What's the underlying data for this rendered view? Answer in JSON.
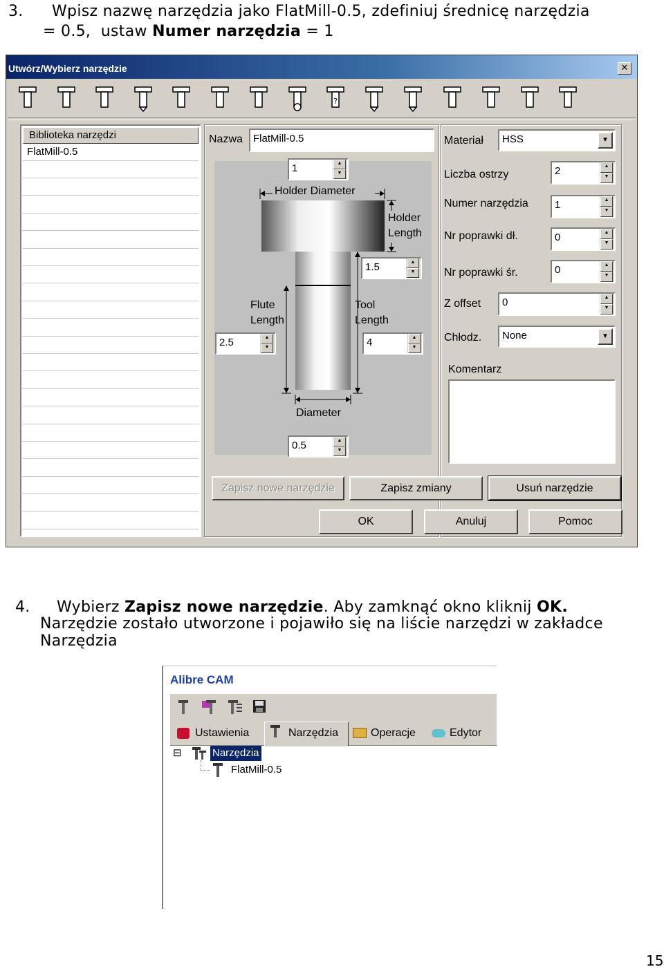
{
  "doc": {
    "step3_num": "3.",
    "step3_line1": "Wpisz nazwę narzędzia jako FlatMill-0.5, zdefiniuj średnicę narzędzia",
    "step3_line2_pre": "= 0.5,  ustaw ",
    "step3_line2_bold": "Numer narzędzia",
    "step3_line2_post": " = 1",
    "step4_num": "4.",
    "step4_pre": "Wybierz ",
    "step4_bold": "Zapisz nowe narzędzie",
    "step4_mid": ". Aby zamknąć okno kliknij ",
    "step4_ok": "OK",
    "step4_end": ".",
    "step4_line2": "Narzędzie zostało utworzone i pojawiło się na liście narzędzi w zakładce",
    "step4_line3": "Narzędzia",
    "page_number": "15"
  },
  "dialog": {
    "title": "Utwórz/Wybierz narzędzie",
    "close_glyph": "✕",
    "toolbar_count": 15,
    "library": {
      "header": "Biblioteka narzędzi",
      "items": [
        "FlatMill-0.5"
      ]
    },
    "name_label": "Nazwa",
    "name_value": "FlatMill-0.5",
    "diagram": {
      "holder_diameter_label": "Holder Diameter",
      "holder_length_label": "Holder Length",
      "flute_length_label": "Flute Length",
      "tool_length_label": "Tool Length",
      "diameter_label": "Diameter",
      "holder_diameter_value": "1",
      "holder_length_value": "1.5",
      "flute_length_value": "2.5",
      "tool_length_value": "4",
      "diameter_value": "0.5"
    },
    "props": {
      "material_label": "Materiał",
      "material_value": "HSS",
      "flutes_label": "Liczba ostrzy",
      "flutes_value": "2",
      "tool_number_label": "Numer narzędzia",
      "tool_number_value": "1",
      "length_offset_label": "Nr poprawki dł.",
      "length_offset_value": "0",
      "dia_offset_label": "Nr poprawki śr.",
      "dia_offset_value": "0",
      "z_offset_label": "Z offset",
      "z_offset_value": "0",
      "coolant_label": "Chłodz.",
      "coolant_value": "None",
      "comment_label": "Komentarz",
      "comment_value": ""
    },
    "buttons": {
      "save_new": "Zapisz nowe narzędzie",
      "save_changes": "Zapisz zmiany",
      "delete_tool": "Usuń narzędzie",
      "ok": "OK",
      "cancel": "Anuluj",
      "help": "Pomoc"
    }
  },
  "alibre": {
    "title": "Alibre CAM",
    "tabs": [
      "Ustawienia",
      "Narzędzia",
      "Operacje",
      "Edytor"
    ],
    "active_tab": "Narzędzia",
    "tree": {
      "expander": "⊟",
      "root": "Narzędzia",
      "child": "FlatMill-0.5"
    }
  }
}
